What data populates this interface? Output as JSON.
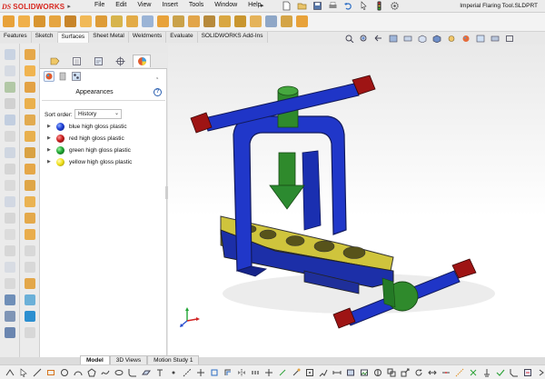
{
  "app": {
    "logo_prefix": "DS",
    "logo_name": "SOLIDWORKS",
    "document_title": "Imperial Flaring Tool.SLDPRT",
    "menu": [
      "File",
      "Edit",
      "View",
      "Insert",
      "Tools",
      "Window",
      "Help"
    ],
    "menu_more": "▸"
  },
  "tabs": [
    "Features",
    "Sketch",
    "Surfaces",
    "Sheet Metal",
    "Weldments",
    "Evaluate",
    "SOLIDWORKS Add-Ins"
  ],
  "active_tab": "Surfaces",
  "panel": {
    "title": "Appearances",
    "help": "?",
    "sort_label": "Sort order:",
    "sort_value": "History",
    "items": [
      {
        "label": "blue high gloss plastic",
        "color": "#1f3fd6"
      },
      {
        "label": "red high gloss plastic",
        "color": "#c81e1e"
      },
      {
        "label": "green high gloss plastic",
        "color": "#1fa631"
      },
      {
        "label": "yellow high gloss plastic",
        "color": "#f2e21a"
      }
    ]
  },
  "bottom_tabs": [
    "Model",
    "3D Views",
    "Motion Study 1"
  ],
  "active_bottom_tab": "Model",
  "colors": {
    "accent": "#d7261e",
    "blue": "#1c2fb8",
    "green": "#2f8a2c",
    "yellow": "#d8d04a",
    "red": "#a31616"
  }
}
